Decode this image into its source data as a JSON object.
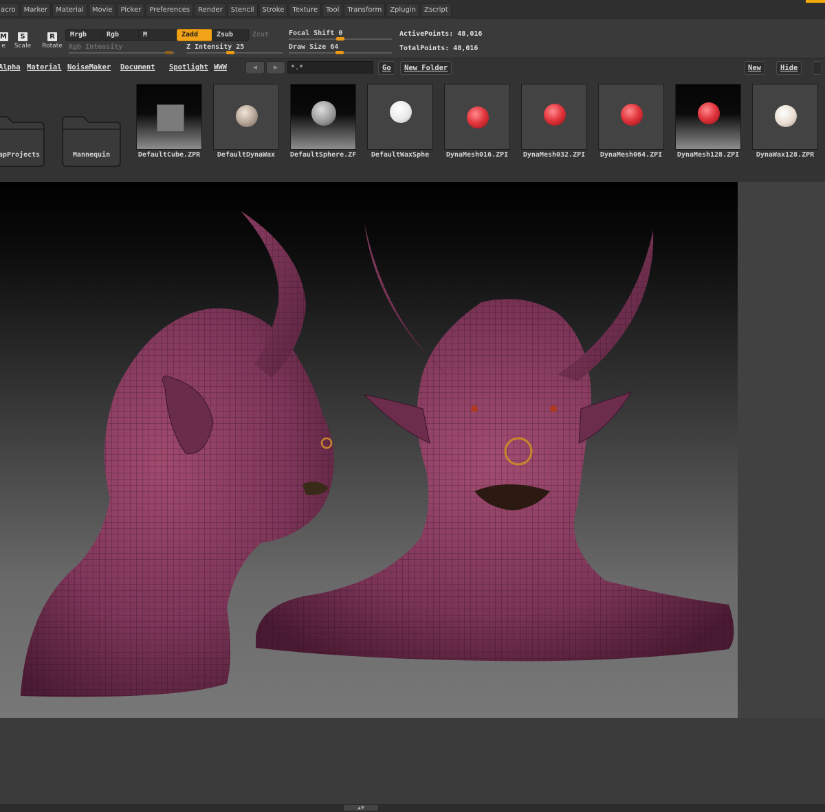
{
  "menu": [
    "acro",
    "Marker",
    "Material",
    "Movie",
    "Picker",
    "Preferences",
    "Render",
    "Stencil",
    "Stroke",
    "Texture",
    "Tool",
    "Transform",
    "Zplugin",
    "Zscript"
  ],
  "tools": [
    {
      "glyph": "M",
      "label": "e"
    },
    {
      "glyph": "S",
      "label": "Scale"
    },
    {
      "glyph": "R",
      "label": "Rotate"
    }
  ],
  "modes": {
    "mrgb": "Mrgb",
    "rgb": "Rgb",
    "m": "M",
    "zadd": "Zadd",
    "zsub": "Zsub",
    "zcut": "Zcut"
  },
  "sliders": {
    "rgb_intensity": {
      "label": "Rgb Intensity"
    },
    "z_intensity": {
      "label": "Z Intensity 25",
      "value": 25
    },
    "focal_shift": {
      "label": "Focal Shift 0",
      "value": 0
    },
    "draw_size": {
      "label": "Draw Size 64",
      "value": 64
    }
  },
  "stats": {
    "active_points": "ActivePoints: 48,016",
    "total_points": "TotalPoints: 48,016"
  },
  "lightbox": {
    "tabs": [
      "Alpha",
      "Material",
      "NoiseMaker",
      "Document",
      "Spotlight",
      "WWW"
    ],
    "search_value": "*.*",
    "go_label": "Go",
    "new_folder_label": "New Folder",
    "new_label": "New",
    "hide_label": "Hide",
    "items": [
      {
        "caption": "tCapProjects",
        "kind": "folder"
      },
      {
        "caption": "Mannequin",
        "kind": "folder"
      },
      {
        "caption": "DefaultCube.ZPR",
        "kind": "cube",
        "bg": "grad"
      },
      {
        "caption": "DefaultDynaWax",
        "kind": "ball",
        "bg": "light",
        "color": "#c9b9a8"
      },
      {
        "caption": "DefaultSphere.ZF",
        "kind": "ball",
        "bg": "grad",
        "color": "#a4a4a4"
      },
      {
        "caption": "DefaultWaxSphe",
        "kind": "ball",
        "bg": "light",
        "color": "#f4f4f4"
      },
      {
        "caption": "DynaMesh016.ZPI",
        "kind": "ball",
        "bg": "light",
        "color": "#e2333a"
      },
      {
        "caption": "DynaMesh032.ZPI",
        "kind": "ball",
        "bg": "light",
        "color": "#e2333a"
      },
      {
        "caption": "DynaMesh064.ZPI",
        "kind": "ball",
        "bg": "light",
        "color": "#e2333a"
      },
      {
        "caption": "DynaMesh128.ZPI",
        "kind": "ball",
        "bg": "grad",
        "color": "#e2333a"
      },
      {
        "caption": "DynaWax128.ZPR",
        "kind": "ball",
        "bg": "light",
        "color": "#efe6da"
      }
    ]
  },
  "colors": {
    "accent": "#f2a217",
    "mesh": "#8a3f66",
    "wire": "#3a1428"
  }
}
